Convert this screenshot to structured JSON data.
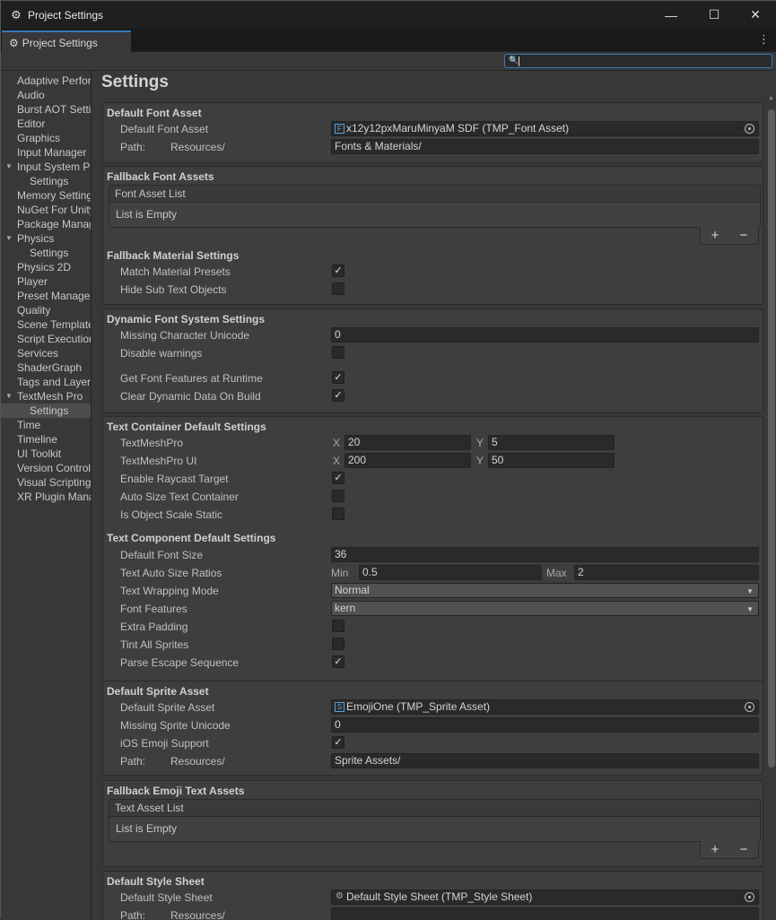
{
  "window": {
    "title": "Project Settings"
  },
  "tab": {
    "label": "Project Settings"
  },
  "sidebar": [
    {
      "label": "Adaptive Performance"
    },
    {
      "label": "Audio"
    },
    {
      "label": "Burst AOT Settings"
    },
    {
      "label": "Editor"
    },
    {
      "label": "Graphics"
    },
    {
      "label": "Input Manager"
    },
    {
      "label": "Input System Package",
      "expanded": true
    },
    {
      "label": "Settings",
      "child": true
    },
    {
      "label": "Memory Settings"
    },
    {
      "label": "NuGet For Unity"
    },
    {
      "label": "Package Manager"
    },
    {
      "label": "Physics",
      "expanded": true
    },
    {
      "label": "Settings",
      "child": true
    },
    {
      "label": "Physics 2D"
    },
    {
      "label": "Player"
    },
    {
      "label": "Preset Manager"
    },
    {
      "label": "Quality"
    },
    {
      "label": "Scene Template"
    },
    {
      "label": "Script Execution Order"
    },
    {
      "label": "Services"
    },
    {
      "label": "ShaderGraph"
    },
    {
      "label": "Tags and Layers"
    },
    {
      "label": "TextMesh Pro",
      "expanded": true
    },
    {
      "label": "Settings",
      "child": true,
      "selected": true
    },
    {
      "label": "Time"
    },
    {
      "label": "Timeline"
    },
    {
      "label": "UI Toolkit"
    },
    {
      "label": "Version Control"
    },
    {
      "label": "Visual Scripting"
    },
    {
      "label": "XR Plugin Management"
    }
  ],
  "content": {
    "heading": "Settings",
    "default_font": {
      "title": "Default Font Asset",
      "asset_label": "Default Font Asset",
      "asset_value": "x12y12pxMaruMinyaM SDF (TMP_Font Asset)",
      "path_label": "Path:",
      "path_prefix": "Resources/",
      "path_value": "Fonts & Materials/"
    },
    "fallback_fonts": {
      "title": "Fallback Font Assets",
      "list_header": "Font Asset List",
      "list_empty": "List is Empty"
    },
    "fallback_material": {
      "title": "Fallback Material Settings",
      "match_label": "Match Material Presets",
      "match_checked": true,
      "hide_label": "Hide Sub Text Objects",
      "hide_checked": false
    },
    "dynamic": {
      "title": "Dynamic Font System Settings",
      "missing_label": "Missing Character Unicode",
      "missing_value": "0",
      "disable_label": "Disable warnings",
      "disable_checked": false,
      "features_label": "Get Font Features at Runtime",
      "features_checked": true,
      "clear_label": "Clear Dynamic Data On Build",
      "clear_checked": true
    },
    "container": {
      "title": "Text Container Default Settings",
      "tmp_label": "TextMeshPro",
      "tmp_x": "20",
      "tmp_y": "5",
      "tmpui_label": "TextMeshPro UI",
      "tmpui_x": "200",
      "tmpui_y": "50",
      "x_axis": "X",
      "y_axis": "Y",
      "raycast_label": "Enable Raycast Target",
      "raycast_checked": true,
      "autosize_label": "Auto Size Text Container",
      "autosize_checked": false,
      "scale_label": "Is Object Scale Static",
      "scale_checked": false
    },
    "component": {
      "title": "Text Component Default Settings",
      "size_label": "Default Font Size",
      "size_value": "36",
      "ratio_label": "Text Auto Size Ratios",
      "min_label": "Min",
      "min_value": "0.5",
      "max_label": "Max",
      "max_value": "2",
      "wrap_label": "Text Wrapping Mode",
      "wrap_value": "Normal",
      "features_label": "Font Features",
      "features_value": "kern",
      "padding_label": "Extra Padding",
      "padding_checked": false,
      "tint_label": "Tint All Sprites",
      "tint_checked": false,
      "escape_label": "Parse Escape Sequence",
      "escape_checked": true
    },
    "sprite": {
      "title": "Default Sprite Asset",
      "asset_label": "Default Sprite Asset",
      "asset_value": "EmojiOne (TMP_Sprite Asset)",
      "missing_label": "Missing Sprite Unicode",
      "missing_value": "0",
      "ios_label": "iOS Emoji Support",
      "ios_checked": true,
      "path_label": "Path:",
      "path_prefix": "Resources/",
      "path_value": "Sprite Assets/"
    },
    "emoji": {
      "title": "Fallback Emoji Text Assets",
      "list_header": "Text Asset List",
      "list_empty": "List is Empty"
    },
    "style": {
      "title": "Default Style Sheet",
      "asset_label": "Default Style Sheet",
      "asset_value": "Default Style Sheet (TMP_Style Sheet)",
      "path_label": "Path:",
      "path_prefix": "Resources/",
      "path_value": ""
    }
  },
  "icons": {
    "check": "✓",
    "plus": "+",
    "minus": "−",
    "minimize": "—",
    "maximize": "☐",
    "close": "✕",
    "kebab": "⋮",
    "gear": "⚙",
    "unity_logo": "⚙",
    "search": "🔍",
    "font_asset": "F",
    "sprite_asset": "S",
    "style_sheet": "⚙",
    "expand_arrow": "▼"
  }
}
